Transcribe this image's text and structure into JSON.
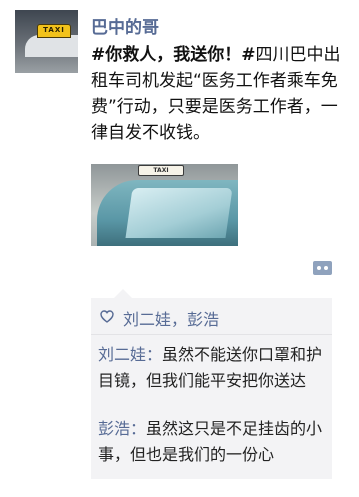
{
  "post": {
    "author": "巴中的哥",
    "content_bold": "#你救人，我送你！#",
    "content": "四川巴中出租车司机发起“医务工作者乘车免费”行动，只要是医务工作者，一律自发不收钱。",
    "avatar_sign_text": "TAXI",
    "photo_sign_text": "TAXI"
  },
  "likes": {
    "names": "刘二娃，彭浩"
  },
  "comments": [
    {
      "author": "刘二娃：",
      "text": "虽然不能送你口罩和护目镜，但我们能平安把你送达"
    },
    {
      "author": "彭浩：",
      "text": "虽然这只是不足挂齿的小事，但也是我们的一份心"
    }
  ],
  "icons": {
    "like": "heart-outline-icon",
    "comment": "comment-dots-icon"
  },
  "colors": {
    "link": "#576b95",
    "panel_bg": "#f3f3f5",
    "comment_button": "#8fa2bd"
  }
}
